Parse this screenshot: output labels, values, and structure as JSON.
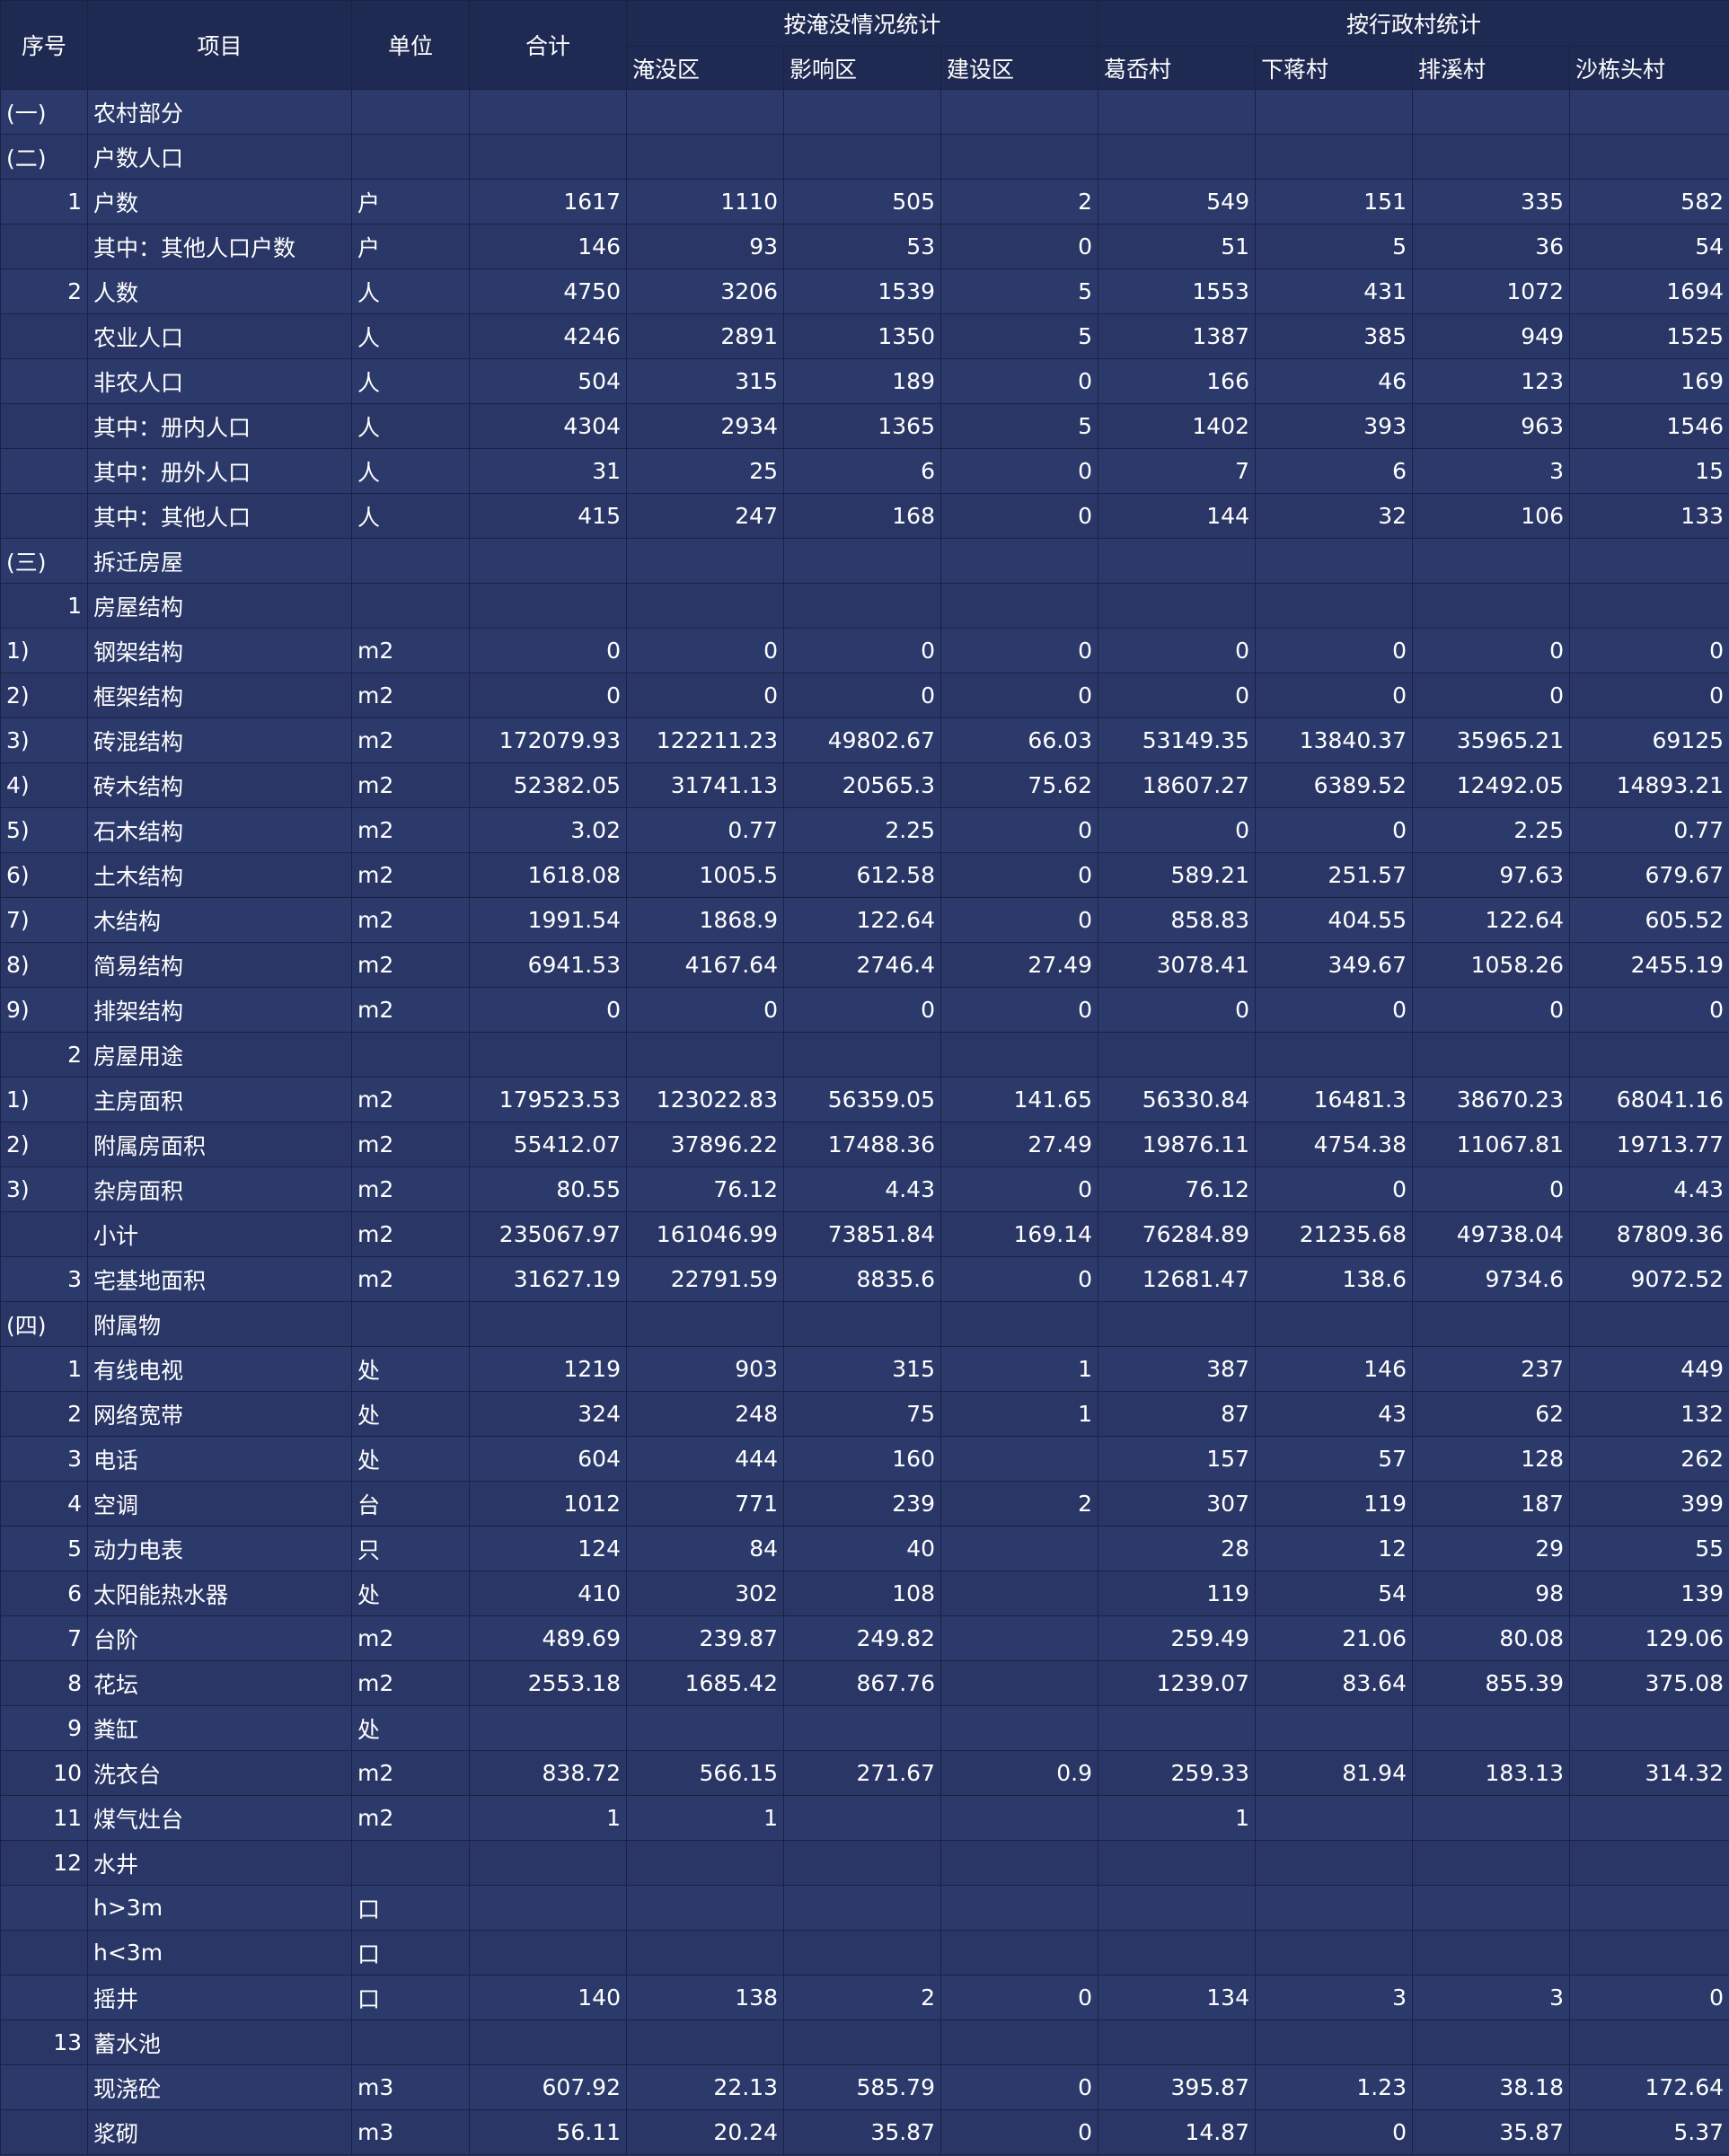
{
  "table": {
    "headers": {
      "seq": "序号",
      "item": "项目",
      "unit": "单位",
      "total": "合计",
      "group_inundation": "按淹没情况统计",
      "group_village": "按行政村统计",
      "sub": [
        "淹没区",
        "影响区",
        "建设区",
        "葛岙村",
        "下蒋村",
        "排溪村",
        "沙栋头村"
      ]
    },
    "rows": [
      {
        "seq": "(一)",
        "item": "农村部分",
        "unit": "",
        "vals": [
          "",
          "",
          "",
          "",
          "",
          "",
          "",
          ""
        ]
      },
      {
        "seq": "(二)",
        "item": "户数人口",
        "unit": "",
        "vals": [
          "",
          "",
          "",
          "",
          "",
          "",
          "",
          ""
        ]
      },
      {
        "seq": "1",
        "item": "户数",
        "unit": "户",
        "vals": [
          "1617",
          "1110",
          "505",
          "2",
          "549",
          "151",
          "335",
          "582"
        ]
      },
      {
        "seq": "",
        "item": "其中：其他人口户数",
        "unit": "户",
        "vals": [
          "146",
          "93",
          "53",
          "0",
          "51",
          "5",
          "36",
          "54"
        ]
      },
      {
        "seq": "2",
        "item": "人数",
        "unit": "人",
        "vals": [
          "4750",
          "3206",
          "1539",
          "5",
          "1553",
          "431",
          "1072",
          "1694"
        ]
      },
      {
        "seq": "",
        "item": "农业人口",
        "unit": "人",
        "vals": [
          "4246",
          "2891",
          "1350",
          "5",
          "1387",
          "385",
          "949",
          "1525"
        ]
      },
      {
        "seq": "",
        "item": "非农人口",
        "unit": "人",
        "vals": [
          "504",
          "315",
          "189",
          "0",
          "166",
          "46",
          "123",
          "169"
        ]
      },
      {
        "seq": "",
        "item": "其中：册内人口",
        "unit": "人",
        "vals": [
          "4304",
          "2934",
          "1365",
          "5",
          "1402",
          "393",
          "963",
          "1546"
        ]
      },
      {
        "seq": "",
        "item": "其中：册外人口",
        "unit": "人",
        "vals": [
          "31",
          "25",
          "6",
          "0",
          "7",
          "6",
          "3",
          "15"
        ]
      },
      {
        "seq": "",
        "item": "其中：其他人口",
        "unit": "人",
        "vals": [
          "415",
          "247",
          "168",
          "0",
          "144",
          "32",
          "106",
          "133"
        ]
      },
      {
        "seq": "(三)",
        "item": "拆迁房屋",
        "unit": "",
        "vals": [
          "",
          "",
          "",
          "",
          "",
          "",
          "",
          ""
        ]
      },
      {
        "seq": "1",
        "item": "房屋结构",
        "unit": "",
        "vals": [
          "",
          "",
          "",
          "",
          "",
          "",
          "",
          ""
        ]
      },
      {
        "seq": "1)",
        "item": "钢架结构",
        "unit": "m2",
        "vals": [
          "0",
          "0",
          "0",
          "0",
          "0",
          "0",
          "0",
          "0"
        ]
      },
      {
        "seq": "2)",
        "item": "框架结构",
        "unit": "m2",
        "vals": [
          "0",
          "0",
          "0",
          "0",
          "0",
          "0",
          "0",
          "0"
        ]
      },
      {
        "seq": "3)",
        "item": "砖混结构",
        "unit": "m2",
        "vals": [
          "172079.93",
          "122211.23",
          "49802.67",
          "66.03",
          "53149.35",
          "13840.37",
          "35965.21",
          "69125"
        ]
      },
      {
        "seq": "4)",
        "item": "砖木结构",
        "unit": "m2",
        "vals": [
          "52382.05",
          "31741.13",
          "20565.3",
          "75.62",
          "18607.27",
          "6389.52",
          "12492.05",
          "14893.21"
        ]
      },
      {
        "seq": "5)",
        "item": "石木结构",
        "unit": "m2",
        "vals": [
          "3.02",
          "0.77",
          "2.25",
          "0",
          "0",
          "0",
          "2.25",
          "0.77"
        ]
      },
      {
        "seq": "6)",
        "item": "土木结构",
        "unit": "m2",
        "vals": [
          "1618.08",
          "1005.5",
          "612.58",
          "0",
          "589.21",
          "251.57",
          "97.63",
          "679.67"
        ]
      },
      {
        "seq": "7)",
        "item": "木结构",
        "unit": "m2",
        "vals": [
          "1991.54",
          "1868.9",
          "122.64",
          "0",
          "858.83",
          "404.55",
          "122.64",
          "605.52"
        ]
      },
      {
        "seq": "8)",
        "item": "简易结构",
        "unit": "m2",
        "vals": [
          "6941.53",
          "4167.64",
          "2746.4",
          "27.49",
          "3078.41",
          "349.67",
          "1058.26",
          "2455.19"
        ]
      },
      {
        "seq": "9)",
        "item": "排架结构",
        "unit": "m2",
        "vals": [
          "0",
          "0",
          "0",
          "0",
          "0",
          "0",
          "0",
          "0"
        ]
      },
      {
        "seq": "2",
        "item": "房屋用途",
        "unit": "",
        "vals": [
          "",
          "",
          "",
          "",
          "",
          "",
          "",
          ""
        ]
      },
      {
        "seq": "1)",
        "item": "主房面积",
        "unit": "m2",
        "vals": [
          "179523.53",
          "123022.83",
          "56359.05",
          "141.65",
          "56330.84",
          "16481.3",
          "38670.23",
          "68041.16"
        ]
      },
      {
        "seq": "2)",
        "item": "附属房面积",
        "unit": "m2",
        "vals": [
          "55412.07",
          "37896.22",
          "17488.36",
          "27.49",
          "19876.11",
          "4754.38",
          "11067.81",
          "19713.77"
        ]
      },
      {
        "seq": "3)",
        "item": "杂房面积",
        "unit": "m2",
        "vals": [
          "80.55",
          "76.12",
          "4.43",
          "0",
          "76.12",
          "0",
          "0",
          "4.43"
        ]
      },
      {
        "seq": "",
        "item": "小计",
        "unit": "m2",
        "vals": [
          "235067.97",
          "161046.99",
          "73851.84",
          "169.14",
          "76284.89",
          "21235.68",
          "49738.04",
          "87809.36"
        ]
      },
      {
        "seq": "3",
        "item": "宅基地面积",
        "unit": "m2",
        "vals": [
          "31627.19",
          "22791.59",
          "8835.6",
          "0",
          "12681.47",
          "138.6",
          "9734.6",
          "9072.52"
        ]
      },
      {
        "seq": "(四)",
        "item": "附属物",
        "unit": "",
        "vals": [
          "",
          "",
          "",
          "",
          "",
          "",
          "",
          ""
        ]
      },
      {
        "seq": "1",
        "item": "有线电视",
        "unit": "处",
        "vals": [
          "1219",
          "903",
          "315",
          "1",
          "387",
          "146",
          "237",
          "449"
        ]
      },
      {
        "seq": "2",
        "item": "网络宽带",
        "unit": "处",
        "vals": [
          "324",
          "248",
          "75",
          "1",
          "87",
          "43",
          "62",
          "132"
        ]
      },
      {
        "seq": "3",
        "item": "电话",
        "unit": "处",
        "vals": [
          "604",
          "444",
          "160",
          "",
          "157",
          "57",
          "128",
          "262"
        ]
      },
      {
        "seq": "4",
        "item": "空调",
        "unit": "台",
        "vals": [
          "1012",
          "771",
          "239",
          "2",
          "307",
          "119",
          "187",
          "399"
        ]
      },
      {
        "seq": "5",
        "item": "动力电表",
        "unit": "只",
        "vals": [
          "124",
          "84",
          "40",
          "",
          "28",
          "12",
          "29",
          "55"
        ]
      },
      {
        "seq": "6",
        "item": "太阳能热水器",
        "unit": "处",
        "vals": [
          "410",
          "302",
          "108",
          "",
          "119",
          "54",
          "98",
          "139"
        ]
      },
      {
        "seq": "7",
        "item": "台阶",
        "unit": "m2",
        "vals": [
          "489.69",
          "239.87",
          "249.82",
          "",
          "259.49",
          "21.06",
          "80.08",
          "129.06"
        ]
      },
      {
        "seq": "8",
        "item": "花坛",
        "unit": "m2",
        "vals": [
          "2553.18",
          "1685.42",
          "867.76",
          "",
          "1239.07",
          "83.64",
          "855.39",
          "375.08"
        ]
      },
      {
        "seq": "9",
        "item": "粪缸",
        "unit": "处",
        "vals": [
          "",
          "",
          "",
          "",
          "",
          "",
          "",
          ""
        ]
      },
      {
        "seq": "10",
        "item": "洗衣台",
        "unit": "m2",
        "vals": [
          "838.72",
          "566.15",
          "271.67",
          "0.9",
          "259.33",
          "81.94",
          "183.13",
          "314.32"
        ]
      },
      {
        "seq": "11",
        "item": "煤气灶台",
        "unit": "m2",
        "vals": [
          "1",
          "1",
          "",
          "",
          "1",
          "",
          "",
          ""
        ]
      },
      {
        "seq": "12",
        "item": "水井",
        "unit": "",
        "vals": [
          "",
          "",
          "",
          "",
          "",
          "",
          "",
          ""
        ]
      },
      {
        "seq": "",
        "item": "h>3m",
        "unit": "口",
        "vals": [
          "",
          "",
          "",
          "",
          "",
          "",
          "",
          ""
        ]
      },
      {
        "seq": "",
        "item": "h<3m",
        "unit": "口",
        "vals": [
          "",
          "",
          "",
          "",
          "",
          "",
          "",
          ""
        ]
      },
      {
        "seq": "",
        "item": "摇井",
        "unit": "口",
        "vals": [
          "140",
          "138",
          "2",
          "0",
          "134",
          "3",
          "3",
          "0"
        ]
      },
      {
        "seq": "13",
        "item": "蓄水池",
        "unit": "",
        "vals": [
          "",
          "",
          "",
          "",
          "",
          "",
          "",
          ""
        ]
      },
      {
        "seq": "",
        "item": "现浇砼",
        "unit": "m3",
        "vals": [
          "607.92",
          "22.13",
          "585.79",
          "0",
          "395.87",
          "1.23",
          "38.18",
          "172.64"
        ]
      },
      {
        "seq": "",
        "item": "浆砌",
        "unit": "m3",
        "vals": [
          "56.11",
          "20.24",
          "35.87",
          "0",
          "14.87",
          "0",
          "35.87",
          "5.37"
        ]
      }
    ]
  }
}
